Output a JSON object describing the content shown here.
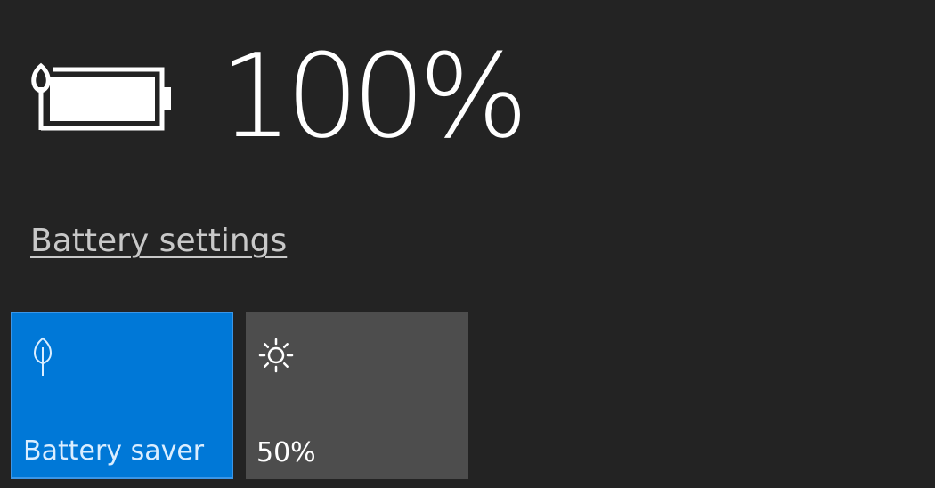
{
  "battery": {
    "percent_label": "100%",
    "level_fraction": 1.0,
    "icon": "battery-leaf-icon"
  },
  "links": {
    "settings_label": "Battery settings"
  },
  "quick_actions": [
    {
      "label": "Battery saver",
      "icon": "leaf-icon",
      "active": true,
      "color": "#0078d7"
    },
    {
      "label": "50%",
      "icon": "brightness-sun-icon",
      "active": false,
      "color": "#4d4d4d"
    }
  ]
}
